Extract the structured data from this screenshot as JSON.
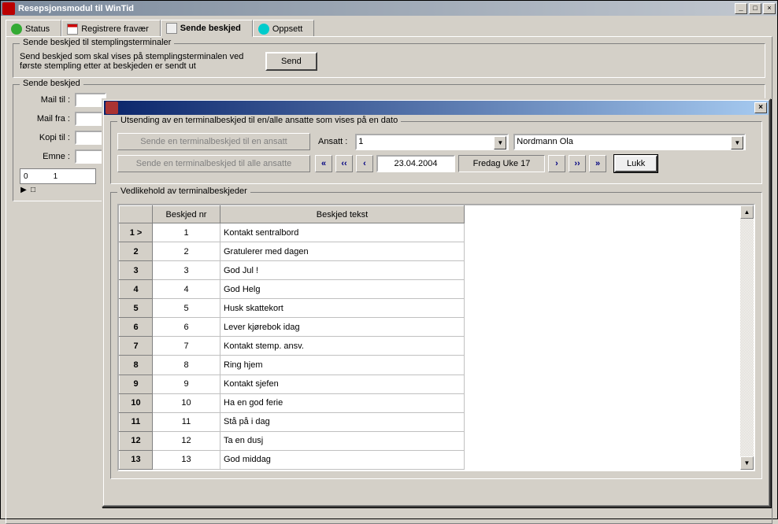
{
  "window": {
    "title": "Resepsjonsmodul til WinTid"
  },
  "tabs": {
    "status": "Status",
    "registrere": "Registrere fravær",
    "sende": "Sende beskjed",
    "oppsett": "Oppsett"
  },
  "upper_group": {
    "legend": "Sende beskjed til stemplingsterminaler",
    "desc": "Send beskjed som skal vises på stemplingsterminalen ved første stempling etter at beskjeden er sendt ut",
    "send_btn": "Send"
  },
  "lower_group": {
    "legend": "Sende beskjed",
    "mail_til": "Mail til :",
    "mail_fra": "Mail fra :",
    "kopi_til": "Kopi til :",
    "emne": "Emne :",
    "ruler_0": "0",
    "ruler_1": "1"
  },
  "dialog": {
    "group1_legend": "Utsending av en terminalbeskjed til en/alle ansatte som vises på en dato",
    "btn_one": "Sende en terminalbeskjed til en ansatt",
    "btn_all": "Sende en terminalbeskjed til alle ansatte",
    "ansatt_label": "Ansatt :",
    "ansatt_id": "1",
    "ansatt_name": "Nordmann Ola",
    "nav_first": "«",
    "nav_prevfast": "‹‹",
    "nav_prev": "‹",
    "date": "23.04.2004",
    "day_week": "Fredag  Uke 17",
    "nav_next": "›",
    "nav_nextfast": "››",
    "nav_last": "»",
    "lukk": "Lukk",
    "group2_legend": "Vedlikehold av terminalbeskjeder",
    "col_nr": "Beskjed nr",
    "col_txt": "Beskjed tekst",
    "rows": [
      {
        "hdr": "1 >",
        "nr": "1",
        "txt": "Kontakt sentralbord"
      },
      {
        "hdr": "2",
        "nr": "2",
        "txt": "Gratulerer med dagen"
      },
      {
        "hdr": "3",
        "nr": "3",
        "txt": "God Jul !"
      },
      {
        "hdr": "4",
        "nr": "4",
        "txt": "God Helg"
      },
      {
        "hdr": "5",
        "nr": "5",
        "txt": "Husk skattekort"
      },
      {
        "hdr": "6",
        "nr": "6",
        "txt": "Lever kjørebok idag"
      },
      {
        "hdr": "7",
        "nr": "7",
        "txt": "Kontakt stemp. ansv."
      },
      {
        "hdr": "8",
        "nr": "8",
        "txt": "Ring hjem"
      },
      {
        "hdr": "9",
        "nr": "9",
        "txt": "Kontakt sjefen"
      },
      {
        "hdr": "10",
        "nr": "10",
        "txt": "Ha en god ferie"
      },
      {
        "hdr": "11",
        "nr": "11",
        "txt": "Stå på i dag"
      },
      {
        "hdr": "12",
        "nr": "12",
        "txt": "Ta en dusj"
      },
      {
        "hdr": "13",
        "nr": "13",
        "txt": "God middag"
      }
    ]
  }
}
